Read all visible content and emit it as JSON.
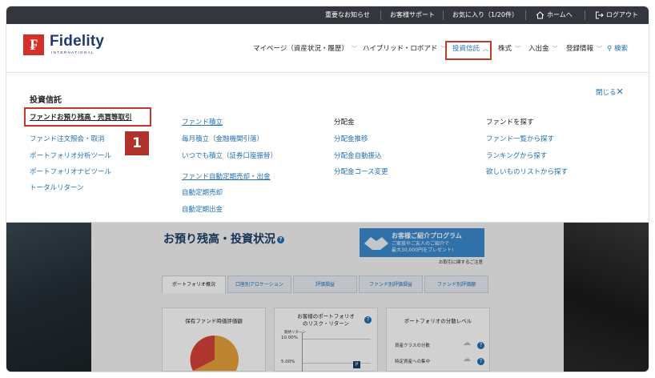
{
  "topbar": {
    "items": [
      "重要なお知らせ",
      "お客様サポート",
      "お気に入り（1/20件）",
      "ホームへ",
      "ログアウト"
    ]
  },
  "brand": {
    "name": "Fidelity",
    "sub": "INTERNATIONAL",
    "logo_char": "₣",
    "color": "#d33027"
  },
  "nav": {
    "items": [
      "マイページ（資産状況・履歴）",
      "ハイブリッド・ロボアド",
      "投資信託",
      "株式",
      "入出金",
      "登録情報"
    ],
    "search": "検索",
    "active": "投資信託"
  },
  "panel": {
    "title": "投資信託",
    "close": "閉じる",
    "col1": [
      "ファンドお預り残高・売買等取引",
      "ファンド注文照会・取消",
      "ポートフォリオ分析ツール",
      "ポートフォリオナビツール",
      "トータルリターン"
    ],
    "col2": {
      "head1": "ファンド積立",
      "items1": [
        "毎月積立（金融機関引落）",
        "いつでも積立（証券口座振替）"
      ],
      "head2": "ファンド自動定期売却・出金",
      "items2": [
        "自動定期売却",
        "自動定期出金"
      ]
    },
    "col3": {
      "head": "分配金",
      "items": [
        "分配金推移",
        "分配金自動振込",
        "分配金コース変更"
      ]
    },
    "col4": {
      "head": "ファンドを探す",
      "items": [
        "ファンド一覧から探す",
        "ランキングから探す",
        "欲しいものリストから探す"
      ]
    },
    "step_badge": "1"
  },
  "background_page": {
    "title": "お預り残高・投資状況",
    "banner_title": "お客様ご紹介プログラム",
    "banner_line1": "ご家族やご友人のご紹介で",
    "banner_line2": "最大30,000円をプレゼント!",
    "banner_note": "お取引に関するご注意",
    "tabs": [
      "ポートフォリオ概況",
      "口座別アロケーション",
      "評価損益",
      "ファンド別評価損益",
      "ファンド別評価額"
    ],
    "card1_title": "保有ファンド時価評価額",
    "card2_title_1": "お客様のポートフォリオ",
    "card2_title_2": "のリスク・リターン",
    "card2_ylabel": "期待リターン",
    "card2_tick1": "10.00%",
    "card2_tick2": "5.00%",
    "card2_marker": "P",
    "card3_title": "ポートフォリオの分散レベル",
    "card3_row1": "資産クラスの分散",
    "card3_row2": "特定資産への集中"
  },
  "colors": {
    "accent_red": "#c0392b",
    "link_blue": "#1f6fb2",
    "topbar": "#33373d",
    "brand_navy": "#1f3a6e"
  }
}
